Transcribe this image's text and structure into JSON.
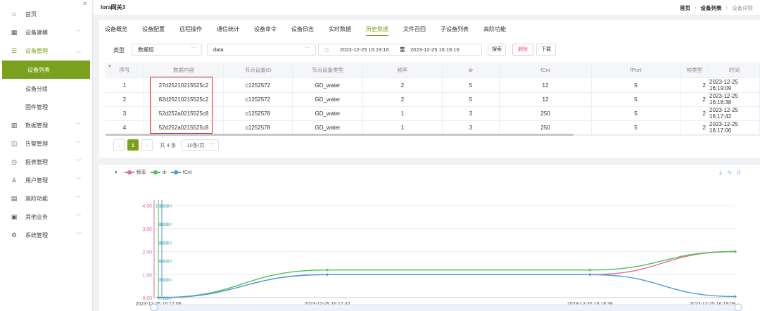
{
  "sidebar": {
    "collapse_glyph": "≡",
    "items": [
      {
        "label": "首页",
        "icon": "home-icon",
        "glyph": "⌂",
        "arrow": ""
      },
      {
        "label": "设备建模",
        "icon": "model-icon",
        "glyph": "▦",
        "arrow": "﹀"
      },
      {
        "label": "设备管理",
        "icon": "device-icon",
        "glyph": "☰",
        "arrow": "︿"
      },
      {
        "label": "数据管理",
        "icon": "chart-icon",
        "glyph": "▥",
        "arrow": "﹀"
      },
      {
        "label": "告警管理",
        "icon": "alarm-icon",
        "glyph": "◫",
        "arrow": "﹀"
      },
      {
        "label": "报表管理",
        "icon": "clock-icon",
        "glyph": "◷",
        "arrow": "﹀"
      },
      {
        "label": "用户管理",
        "icon": "user-icon",
        "glyph": "♙",
        "arrow": "﹀"
      },
      {
        "label": "高阶功能",
        "icon": "advanced-icon",
        "glyph": "▤",
        "arrow": "﹀"
      },
      {
        "label": "其他业务",
        "icon": "other-icon",
        "glyph": "▣",
        "arrow": "﹀"
      },
      {
        "label": "系统管理",
        "icon": "settings-icon",
        "glyph": "⚙",
        "arrow": "﹀"
      }
    ],
    "sub_items": [
      "设备列表",
      "设备分组",
      "固件管理"
    ],
    "accent": "#7aa11e"
  },
  "header": {
    "title": "lora网关3",
    "breadcrumb": [
      "首页",
      "设备列表",
      "设备详情"
    ],
    "separator": "›"
  },
  "tabs": [
    "设备概览",
    "设备配置",
    "远程操作",
    "通信统计",
    "设备命令",
    "设备日志",
    "实时数据",
    "历史数据",
    "文件召回",
    "子设备列表",
    "高阶功能"
  ],
  "active_tab": "历史数据",
  "filter": {
    "type_label": "类型",
    "type_value": "数据组",
    "data_value": "data",
    "date_start": "2023-12-25 15:19:16",
    "date_sep": "至",
    "date_end": "2023-12-25 16:19:16",
    "search_label": "搜索",
    "delete_label": "删除",
    "download_label": "下载",
    "chevron": "﹀",
    "clock_glyph": "◷"
  },
  "table": {
    "sort_glyph": "▾",
    "columns": [
      "序号",
      "数据内容",
      "节点设备ID",
      "节点设备类型",
      "频率",
      "dr",
      "fCnt",
      "fPort",
      "帧类型",
      "时间"
    ],
    "rows": [
      [
        "1",
        "27d25210215525c2",
        "c1252572",
        "GD_water",
        "2",
        "5",
        "12",
        "5",
        "2",
        "2023-12-25 16:19:09"
      ],
      [
        "2",
        "82d25210215525c2",
        "c1252572",
        "GD_water",
        "2",
        "5",
        "12",
        "5",
        "2",
        "2023-12-25 16:18:38"
      ],
      [
        "3",
        "52d252a0215525c8",
        "c1252578",
        "GD_water",
        "1",
        "3",
        "250",
        "5",
        "2",
        "2023-12-25 16:17:42"
      ],
      [
        "4",
        "52d252a0215525c8",
        "c1252578",
        "GD_water",
        "1",
        "3",
        "250",
        "5",
        "2",
        "2023-12-25 16:17:06"
      ]
    ]
  },
  "pagination": {
    "prev": "‹",
    "current": "1",
    "next": "›",
    "total": "共 4 条",
    "page_size": "10条/页"
  },
  "chart_toolbox": [
    "⤓",
    "∿",
    "ıl"
  ],
  "chart_data": {
    "type": "line",
    "x": [
      "2023-12-25 16:17:06",
      "2023-12-25 16:17:42",
      "2023-12-25 16:18:38",
      "2023-12-25 16:19:09"
    ],
    "x_tick_labels": [
      "2023-12-25 16:17:06",
      "2023-12-25 16:17:42",
      "2023-12-25 16:18:38",
      "2023-12-25 16:19:09"
    ],
    "series": [
      {
        "name": "频率",
        "color": "#e8689a",
        "values": [
          0.0,
          1.0,
          1.0,
          2.0
        ],
        "axis_ticks": [
          "0.00",
          "1.00",
          "2.00",
          "3.00",
          "4.00"
        ]
      },
      {
        "name": "dr",
        "color": "#4cc34f",
        "values": [
          0.0,
          3.0,
          3.0,
          5.0
        ],
        "axis_ticks": [
          "0.00",
          "2.00",
          "4.00",
          "6.00",
          "8.00",
          "10.00"
        ]
      },
      {
        "name": "fCnt",
        "color": "#4b9be2",
        "values": [
          0.0,
          250.0,
          250.0,
          12.0
        ],
        "axis_ticks": [
          "0.00",
          "200.00",
          "400.00",
          "600.00",
          "800.00",
          "1000.00"
        ]
      }
    ],
    "ylim": [
      0,
      4
    ],
    "grid": true,
    "legend": "top-left"
  }
}
